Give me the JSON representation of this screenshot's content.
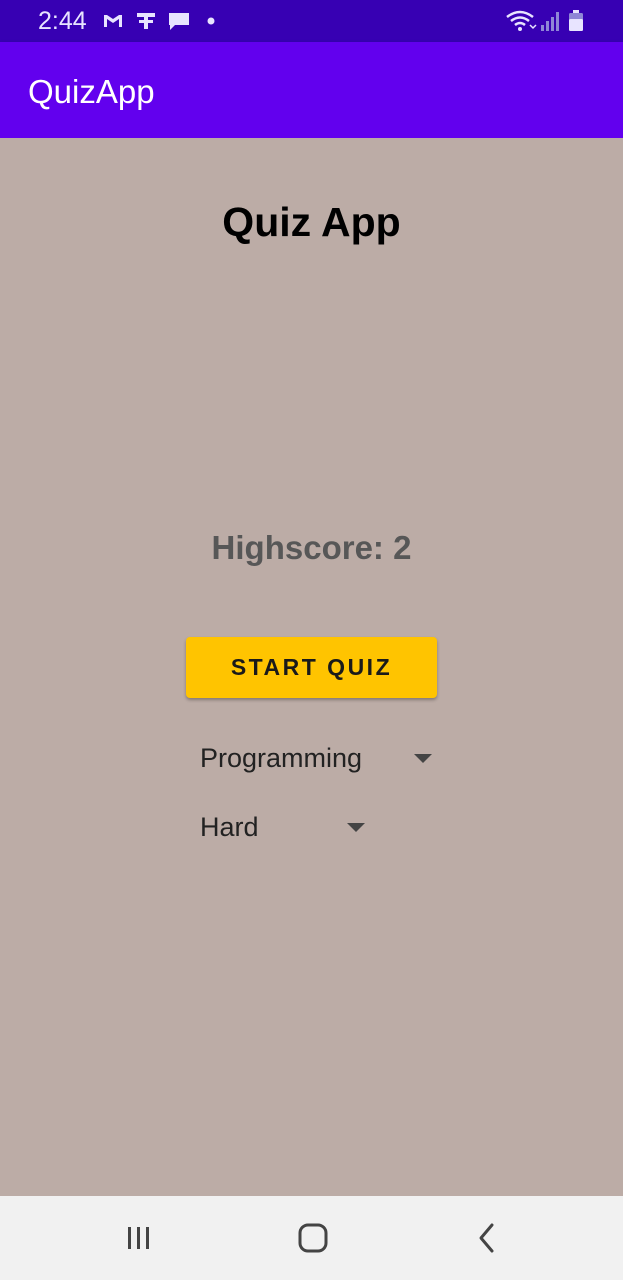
{
  "status_bar": {
    "time": "2:44",
    "icons": [
      "gmail-icon",
      "notification-icon",
      "chat-icon",
      "dot-icon",
      "wifi-icon",
      "signal-icon",
      "battery-icon"
    ]
  },
  "app_bar": {
    "title": "QuizApp"
  },
  "main": {
    "title": "Quiz App",
    "highscore": "Highscore: 2",
    "start_button_label": "START QUIZ",
    "category_selected": "Programming",
    "difficulty_selected": "Hard"
  },
  "nav_bar": {
    "buttons": [
      "recent-apps-icon",
      "home-icon",
      "back-icon"
    ]
  },
  "colors": {
    "status_bar": "#3700b3",
    "app_bar": "#6200ee",
    "background": "#bcaca6",
    "button": "#ffc400",
    "highscore_text": "#575757",
    "nav_bar": "#f1f1f1"
  }
}
